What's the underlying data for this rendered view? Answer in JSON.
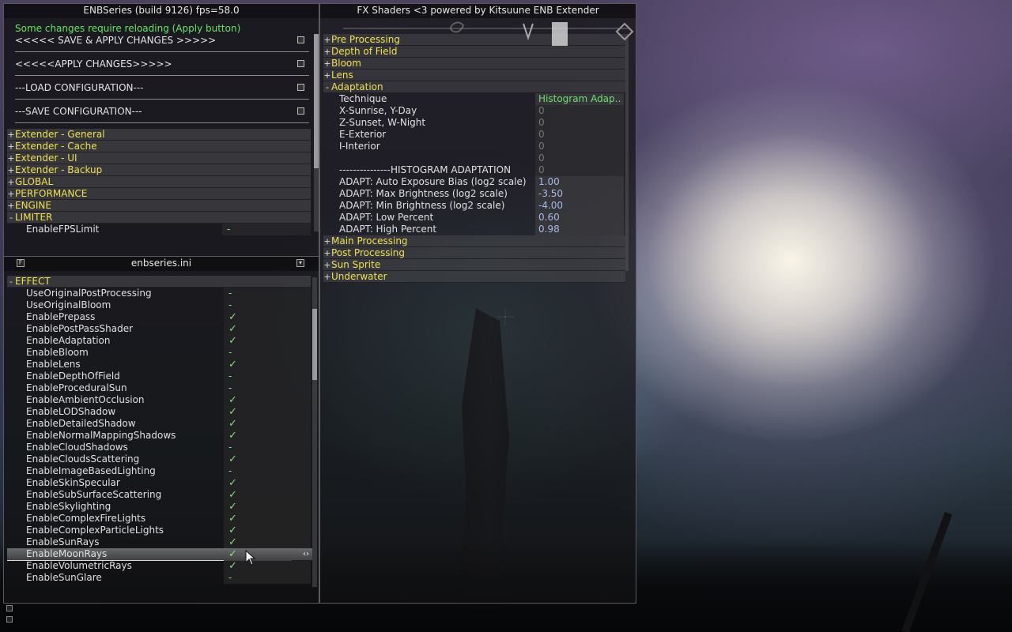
{
  "enb_window": {
    "title": "ENBSeries (build 9126) fps=58.0",
    "notice": "Some changes require reloading (Apply button)",
    "commands": [
      "<<<<< SAVE & APPLY CHANGES >>>>>",
      "<<<<<APPLY CHANGES>>>>>",
      "---LOAD CONFIGURATION---",
      "---SAVE CONFIGURATION---"
    ],
    "sections": [
      {
        "label": "Extender - General",
        "state": "+"
      },
      {
        "label": "Extender - Cache",
        "state": "+"
      },
      {
        "label": "Extender - UI",
        "state": "+"
      },
      {
        "label": "Extender - Backup",
        "state": "+"
      },
      {
        "label": "GLOBAL",
        "state": "+"
      },
      {
        "label": "PERFORMANCE",
        "state": "+"
      },
      {
        "label": "ENGINE",
        "state": "+"
      },
      {
        "label": "LIMITER",
        "state": "-"
      }
    ],
    "limiter_param": {
      "label": "EnableFPSLimit",
      "value": "-"
    }
  },
  "ini_window": {
    "title": "enbseries.ini",
    "section": {
      "label": "EFFECT",
      "state": "-"
    },
    "rows": [
      {
        "label": "UseOriginalPostProcessing",
        "value": "-"
      },
      {
        "label": "UseOriginalBloom",
        "value": "-"
      },
      {
        "label": "EnablePrepass",
        "value": "✓"
      },
      {
        "label": "EnablePostPassShader",
        "value": "✓"
      },
      {
        "label": "EnableAdaptation",
        "value": "✓"
      },
      {
        "label": "EnableBloom",
        "value": "-"
      },
      {
        "label": "EnableLens",
        "value": "✓"
      },
      {
        "label": "EnableDepthOfField",
        "value": "-"
      },
      {
        "label": "EnableProceduralSun",
        "value": "-"
      },
      {
        "label": "EnableAmbientOcclusion",
        "value": "✓"
      },
      {
        "label": "EnableLODShadow",
        "value": "✓"
      },
      {
        "label": "EnableDetailedShadow",
        "value": "✓"
      },
      {
        "label": "EnableNormalMappingShadows",
        "value": "✓"
      },
      {
        "label": "EnableCloudShadows",
        "value": "-"
      },
      {
        "label": "EnableCloudsScattering",
        "value": "✓"
      },
      {
        "label": "EnableImageBasedLighting",
        "value": "-"
      },
      {
        "label": "EnableSkinSpecular",
        "value": "✓"
      },
      {
        "label": "EnableSubSurfaceScattering",
        "value": "✓"
      },
      {
        "label": "EnableSkylighting",
        "value": "✓"
      },
      {
        "label": "EnableComplexFireLights",
        "value": "✓"
      },
      {
        "label": "EnableComplexParticleLights",
        "value": "✓"
      },
      {
        "label": "EnableSunRays",
        "value": "✓"
      },
      {
        "label": "EnableMoonRays",
        "value": "✓"
      },
      {
        "label": "EnableVolumetricRays",
        "value": "✓"
      },
      {
        "label": "EnableSunGlare",
        "value": "-"
      }
    ],
    "highlighted_index": 22,
    "highlight_arrows": "‹›"
  },
  "fx_window": {
    "title": "FX Shaders <3 powered by Kitsuune ENB Extender",
    "sections_top": [
      {
        "label": "Pre Processing",
        "state": "+"
      },
      {
        "label": "Depth of Field",
        "state": "+"
      },
      {
        "label": "Bloom",
        "state": "+"
      },
      {
        "label": "Lens",
        "state": "+"
      },
      {
        "label": "Adaptation",
        "state": "-"
      }
    ],
    "adaptation_rows": [
      {
        "label": "Technique",
        "value": "Histogram Adap..",
        "style": "green"
      },
      {
        "label": "X-Sunrise, Y-Day",
        "value": "0",
        "style": "muted"
      },
      {
        "label": "Z-Sunset, W-Night",
        "value": "0",
        "style": "muted"
      },
      {
        "label": "E-Exterior",
        "value": "0",
        "style": "muted"
      },
      {
        "label": "I-Interior",
        "value": "0",
        "style": "muted"
      },
      {
        "label": "",
        "value": "0",
        "style": "muted"
      },
      {
        "label": "---------------HISTOGRAM ADAPTATION",
        "value": "0",
        "style": "muted"
      },
      {
        "label": "ADAPT: Auto Exposure Bias (log2 scale)",
        "value": "1.00",
        "style": "blue"
      },
      {
        "label": "ADAPT: Max Brightness (log2 scale)",
        "value": "-3.50",
        "style": "blue"
      },
      {
        "label": "ADAPT: Min Brightness (log2 scale)",
        "value": "-4.00",
        "style": "blue"
      },
      {
        "label": "ADAPT: Low Percent",
        "value": "0.60",
        "style": "blue"
      },
      {
        "label": "ADAPT: High Percent",
        "value": "0.98",
        "style": "blue"
      }
    ],
    "sections_bottom": [
      {
        "label": "Main Processing",
        "state": "+"
      },
      {
        "label": "Post Processing",
        "state": "+"
      },
      {
        "label": "Sun Sprite",
        "state": "+"
      },
      {
        "label": "Underwater",
        "state": "+"
      }
    ]
  },
  "icons": {
    "pin": "pin-icon",
    "minimize": "minimize-icon"
  },
  "colors": {
    "section_text": "#f0e050",
    "check": "#7de27d",
    "notice": "#62e862",
    "value_blue": "#a8b8e8"
  }
}
